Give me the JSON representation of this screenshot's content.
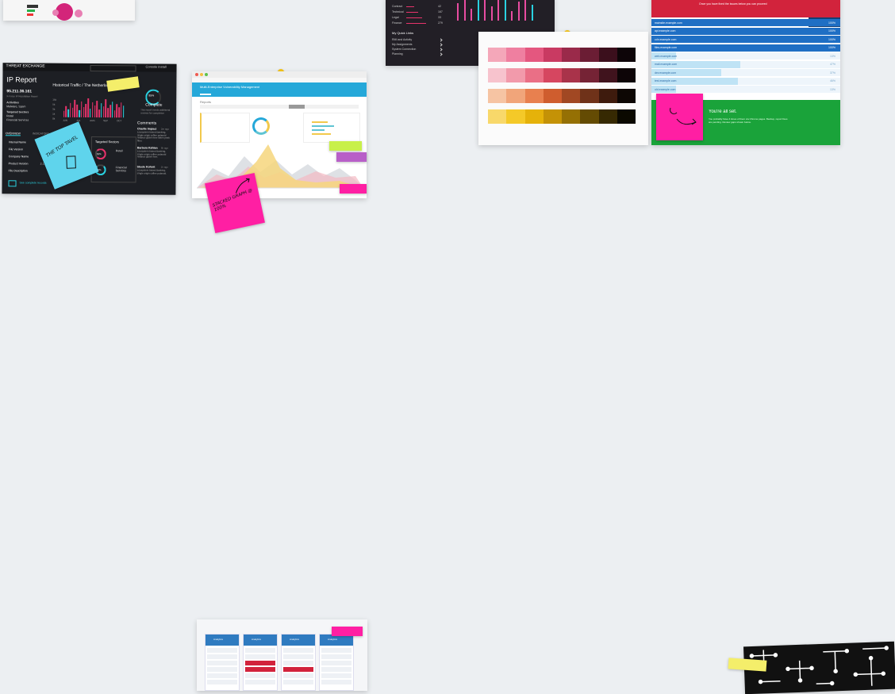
{
  "app": {
    "title": "Design wall"
  },
  "ip_report": {
    "brand": "THREAT EXCHANGE",
    "user": "Console Install",
    "title": "IP Report",
    "ip": "95.211.36.161",
    "subtitle": "X-Force IP Reputation Report",
    "activities_label": "Activities",
    "activities_value": "Malware, Spam",
    "targeted_label": "Targeted Sectors",
    "targeted_values": [
      "Retail",
      "Financial Services"
    ],
    "traffic_title": "Historical Traffic / The Netherlands",
    "bars": [
      8,
      14,
      10,
      18,
      12,
      22,
      16,
      9,
      20,
      13,
      17,
      24,
      11,
      19,
      15,
      21,
      10,
      18,
      14,
      23,
      12,
      16,
      20,
      9,
      17,
      13,
      19,
      15
    ],
    "y_ticks": [
      "15k",
      "5k",
      "3k",
      "1k",
      "0k"
    ],
    "x_ticks": [
      "JUN",
      "JUL",
      "AUG",
      "SEP",
      "OCT"
    ],
    "complete_pct": "95%",
    "complete_label": "Complete",
    "complete_note": "This report needs additional reviews for completion",
    "comments_title": "Comments",
    "comments": [
      {
        "name": "Charlie Impact",
        "time": "2m ago",
        "text": "Ecosystem based Banking, single origin coffee polaroid reliance gluten free kitten yeah fiber."
      },
      {
        "name": "Barbara Kahlen",
        "time": "6h ago",
        "text": "Ecosystem based Banking, single origin coffee polaroid reliance gluten free."
      },
      {
        "name": "Steele Kohort",
        "time": "1h ago",
        "text": "Ecosystem based Banking, single origin coffee polaroid."
      }
    ],
    "tabs": [
      "OVERVIEW",
      "INDICATORS"
    ],
    "fields": [
      {
        "label": "Internal Name",
        "value": ""
      },
      {
        "label": "File Version",
        "value": ""
      },
      {
        "label": "Company Name",
        "value": ""
      },
      {
        "label": "Product Version",
        "value": "2.1."
      },
      {
        "label": "File Description",
        "value": ""
      }
    ],
    "sectors_title": "Targeted Sectors",
    "sectors": [
      {
        "pct": "62%",
        "label": "Retail"
      },
      {
        "pct": "38%",
        "label": "Financial Services"
      }
    ],
    "footer_link": "See complete records",
    "note_text": "THE TOP TAVEL"
  },
  "vuln_mgmt": {
    "header_title": "Multi-Enterprise Vulnerability Management",
    "reports_label": "Reports",
    "sticky_text": "STACKED GRAPH @ 100%"
  },
  "quick_links": {
    "metrics": [
      {
        "label": "Contract",
        "value": "42"
      },
      {
        "label": "Technical",
        "value": "167"
      },
      {
        "label": "Legal",
        "value": "33"
      },
      {
        "label": "Finance",
        "value": "279"
      }
    ],
    "title": "My Quick Links",
    "links": [
      "RMI and Activity",
      "My Assignments",
      "System Connection",
      "Planning"
    ],
    "bar_heights": [
      22,
      35,
      15,
      30,
      40,
      18,
      28,
      36,
      12,
      24,
      38,
      20
    ]
  },
  "palette": {
    "rows": [
      [
        "#f4a7b9",
        "#ef7fa0",
        "#e4577f",
        "#c93a62",
        "#9a2a4a",
        "#6b1d34",
        "#3b0f1c",
        "#0d0508"
      ],
      [
        "#f7c3cd",
        "#f29aab",
        "#ea6f86",
        "#d64660",
        "#a9334a",
        "#752335",
        "#40131d",
        "#0d0507"
      ],
      [
        "#f6c4a3",
        "#f1a57a",
        "#e8804f",
        "#cf5d2e",
        "#a14823",
        "#6f3219",
        "#3e1b0d",
        "#0d0704"
      ],
      [
        "#f8d86a",
        "#f4c928",
        "#e5b20a",
        "#c49206",
        "#957004",
        "#644b03",
        "#362902",
        "#0b0900"
      ]
    ]
  },
  "setup": {
    "top_text": "Once you have fixed the issues below you can proceed",
    "rows": [
      {
        "name": "mainsite.example.com",
        "pct": "100%"
      },
      {
        "name": "api.example.com",
        "pct": "100%"
      },
      {
        "name": "cdn.example.com",
        "pct": "100%"
      },
      {
        "name": "files.example.com",
        "pct": "100%"
      },
      {
        "name": "web.example.com",
        "pct": "13%"
      },
      {
        "name": "mail.example.com",
        "pct": "47%"
      },
      {
        "name": "dev.example.com",
        "pct": "37%"
      },
      {
        "name": "test.example.com",
        "pct": "46%"
      },
      {
        "name": "old.example.com",
        "pct": "13%"
      }
    ],
    "done_title": "You're all set.",
    "done_text": "You probably have 4 times of them via Chrome pages. Backup, report fixes are pending. Review gaps shown below."
  },
  "mobile_sheet": {
    "headers": [
      "Analytics",
      "Analytics",
      "Analytics",
      "Analytics"
    ]
  },
  "colors": {
    "background": "#eceff2",
    "dark": "#1d1f24",
    "accent_cyan": "#2ad1e0",
    "accent_pink": "#e8336b",
    "sticky_yellow": "#f4ee6a",
    "sticky_cyan": "#5fd4ec",
    "sticky_magenta": "#ff1fa3",
    "setup_blue": "#1f6fc4",
    "setup_green": "#1aa33a",
    "setup_red": "#d2233c"
  }
}
